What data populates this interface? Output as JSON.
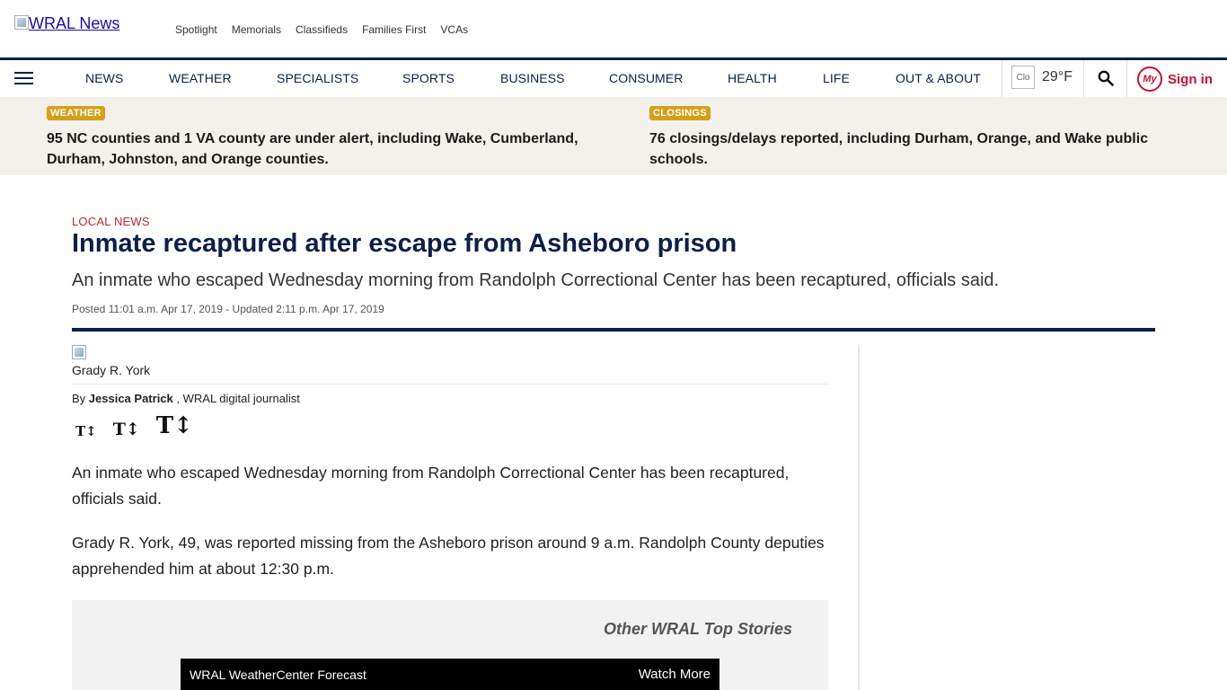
{
  "header": {
    "logo_alt": "WRAL News",
    "top_links": [
      "Spotlight",
      "Memorials",
      "Classifieds",
      "Families First",
      "VCAs"
    ]
  },
  "nav": {
    "items": [
      "NEWS",
      "WEATHER",
      "SPECIALISTS",
      "SPORTS",
      "BUSINESS",
      "CONSUMER",
      "HEALTH",
      "LIFE",
      "OUT & ABOUT"
    ],
    "weather_icon_alt": "Clo",
    "temperature": "29°F",
    "my_badge": "My",
    "signin_label": "Sign in",
    "accent_color": "#0b1f4b",
    "signin_color": "#c8102e"
  },
  "alerts": [
    {
      "tag": "WEATHER",
      "text": "95 NC counties and 1 VA county are under alert, including Wake, Cumberland, Durham, Johnston, and Orange counties."
    },
    {
      "tag": "CLOSINGS",
      "text": "76 closings/delays reported, including Durham, Orange, and Wake public schools."
    }
  ],
  "article": {
    "kicker": "LOCAL NEWS",
    "headline": "Inmate recaptured after escape from Asheboro prison",
    "dek": "An inmate who escaped Wednesday morning from Randolph Correctional Center has been recaptured, officials said.",
    "dateline": "Posted 11:01 a.m. Apr 17, 2019 - Updated 2:11 p.m. Apr 17, 2019",
    "photo_caption": "Grady R. York",
    "byline_prefix": "By",
    "author": "Jessica Patrick",
    "author_role": ", WRAL digital journalist",
    "font_size_glyphs": [
      "T↕",
      "T↕",
      "T↕"
    ],
    "paragraphs": [
      "An inmate who escaped Wednesday morning from Randolph Correctional Center has been recaptured, officials said.",
      "Grady R. York, 49, was reported missing from the Asheboro prison around 9 a.m. Randolph County deputies apprehended him at about 12:30 p.m."
    ]
  },
  "video": {
    "section_title": "Other WRAL Top Stories",
    "player_title": "WRAL WeatherCenter Forecast",
    "watch_more": "Watch More"
  }
}
